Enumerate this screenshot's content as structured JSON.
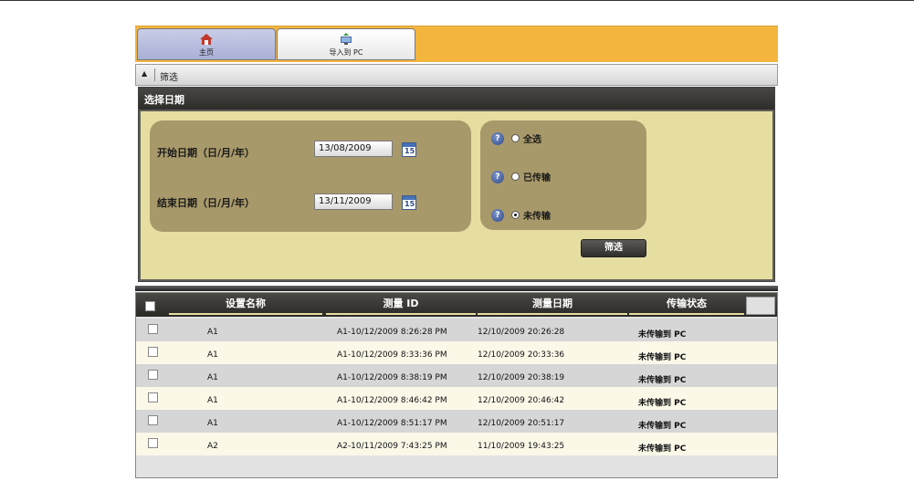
{
  "tabs": [
    {
      "label": "主页",
      "icon": "home-icon"
    },
    {
      "label": "导入到 PC",
      "icon": "export-to-pc-icon"
    }
  ],
  "filterbar": {
    "label": "筛选"
  },
  "panel": {
    "title": "选择日期",
    "start_label": "开始日期（日/月/年）",
    "start_value": "13/08/2009",
    "end_label": "结束日期（日/月/年）",
    "end_value": "13/11/2009",
    "calendar_day": "15",
    "options": [
      {
        "label": "全选",
        "selected": false
      },
      {
        "label": "已传输",
        "selected": false
      },
      {
        "label": "未传输",
        "selected": true
      }
    ],
    "help_glyph": "?",
    "filter_button": "筛选"
  },
  "table": {
    "columns": [
      "设置名称",
      "测量 ID",
      "测量日期",
      "传输状态"
    ],
    "rows": [
      {
        "name": "A1",
        "id": "A1-10/12/2009 8:26:28 PM",
        "date": "12/10/2009 20:26:28",
        "status": "未传输到 PC"
      },
      {
        "name": "A1",
        "id": "A1-10/12/2009 8:33:36 PM",
        "date": "12/10/2009 20:33:36",
        "status": "未传输到 PC"
      },
      {
        "name": "A1",
        "id": "A1-10/12/2009 8:38:19 PM",
        "date": "12/10/2009 20:38:19",
        "status": "未传输到 PC"
      },
      {
        "name": "A1",
        "id": "A1-10/12/2009 8:46:42 PM",
        "date": "12/10/2009 20:46:42",
        "status": "未传输到 PC"
      },
      {
        "name": "A1",
        "id": "A1-10/12/2009 8:51:17 PM",
        "date": "12/10/2009 20:51:17",
        "status": "未传输到 PC"
      },
      {
        "name": "A2",
        "id": "A2-10/11/2009 7:43:25 PM",
        "date": "11/10/2009 19:43:25",
        "status": "未传输到 PC"
      }
    ]
  },
  "colors": {
    "accent": "#f4b53f",
    "panel_bg": "#e6dea0",
    "group_bg": "#a8996a",
    "header_dark": "#2d2c29"
  }
}
